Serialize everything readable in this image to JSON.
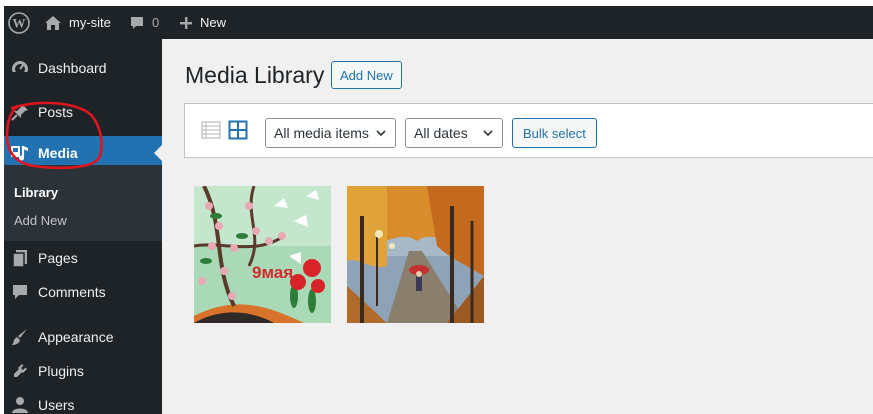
{
  "adminbar": {
    "site_name": "my-site",
    "comment_count": "0",
    "new_label": "New"
  },
  "sidebar": {
    "items": [
      {
        "label": "Dashboard",
        "icon": "dashboard-icon"
      },
      {
        "label": "Posts",
        "icon": "pin-icon"
      },
      {
        "label": "Media",
        "icon": "media-icon",
        "current": true
      },
      {
        "label": "Pages",
        "icon": "pages-icon"
      },
      {
        "label": "Comments",
        "icon": "comment-icon"
      },
      {
        "label": "Appearance",
        "icon": "brush-icon"
      },
      {
        "label": "Plugins",
        "icon": "plugin-icon"
      },
      {
        "label": "Users",
        "icon": "user-icon"
      }
    ],
    "submenu": [
      {
        "label": "Library",
        "current": true
      },
      {
        "label": "Add New"
      }
    ]
  },
  "main": {
    "title": "Media Library",
    "add_new_label": "Add New",
    "filters": {
      "media_type": "All media items",
      "dates": "All dates",
      "bulk_select_label": "Bulk select"
    },
    "thumbnails": [
      {
        "name": "spring-blossom-painting"
      },
      {
        "name": "autumn-park-painting"
      }
    ]
  },
  "colors": {
    "admin_dark": "#1d2327",
    "accent": "#2271b1",
    "background": "#f0f0f1",
    "annotation": "#e0141e"
  }
}
